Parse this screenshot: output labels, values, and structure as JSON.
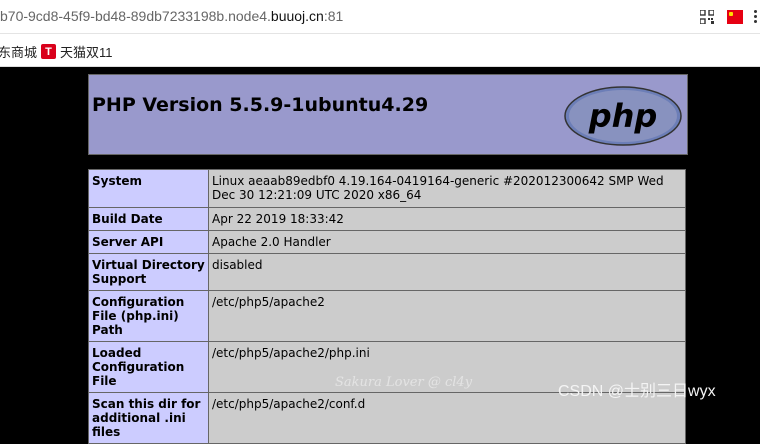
{
  "browser": {
    "url_prefix": "b70-9cd8-45f9-bd48-89db7233198b.node4.",
    "url_host": "buuoj.cn",
    "url_port": ":81",
    "bookmarks": [
      {
        "label": "东商城"
      },
      {
        "label": "天猫双11",
        "icon": "T"
      }
    ]
  },
  "page": {
    "title": "PHP Version 5.5.9-1ubuntu4.29",
    "logo_text": "php",
    "rows": [
      {
        "key": "System",
        "value": "Linux aeaab89edbf0 4.19.164-0419164-generic #202012300642 SMP Wed Dec 30 12:21:09 UTC 2020 x86_64"
      },
      {
        "key": "Build Date",
        "value": "Apr 22 2019 18:33:42"
      },
      {
        "key": "Server API",
        "value": "Apache 2.0 Handler"
      },
      {
        "key": "Virtual Directory Support",
        "value": "disabled"
      },
      {
        "key": "Configuration File (php.ini) Path",
        "value": "/etc/php5/apache2"
      },
      {
        "key": "Loaded Configuration File",
        "value": "/etc/php5/apache2/php.ini"
      },
      {
        "key": "Scan this dir for additional .ini files",
        "value": "/etc/php5/apache2/conf.d"
      }
    ]
  },
  "watermarks": {
    "left": "Sakura Lover @ cl4y",
    "right": "CSDN @士别三日wyx"
  }
}
